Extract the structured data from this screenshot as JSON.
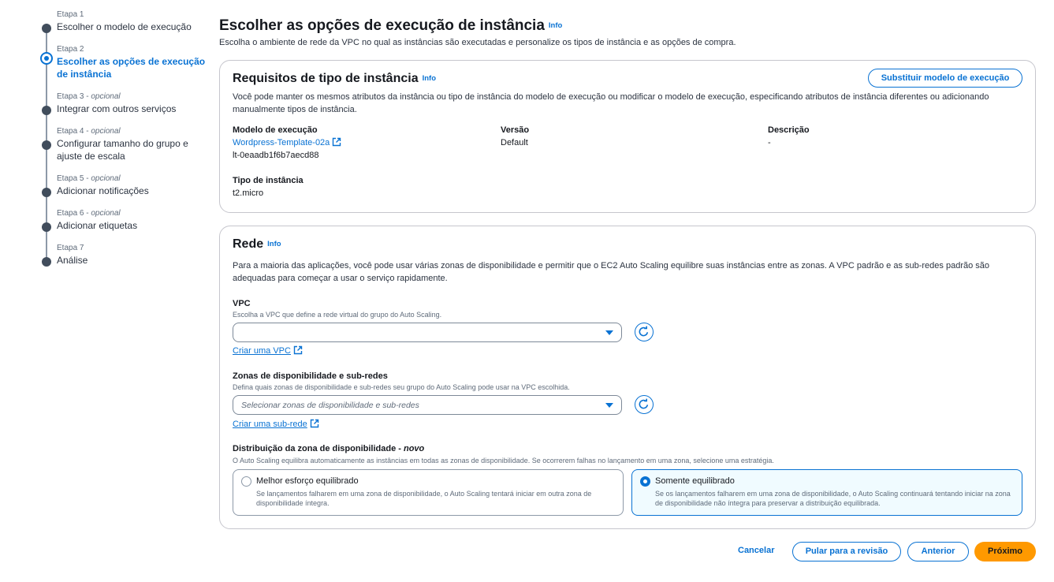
{
  "steps": [
    {
      "num": "Etapa 1",
      "optional": "",
      "label": "Escolher o modelo de execução"
    },
    {
      "num": "Etapa 2",
      "optional": "",
      "label": "Escolher as opções de execução de instância"
    },
    {
      "num": "Etapa 3",
      "optional": "opcional",
      "label": "Integrar com outros serviços"
    },
    {
      "num": "Etapa 4",
      "optional": "opcional",
      "label": "Configurar tamanho do grupo e ajuste de escala"
    },
    {
      "num": "Etapa 5",
      "optional": "opcional",
      "label": "Adicionar notificações"
    },
    {
      "num": "Etapa 6",
      "optional": "opcional",
      "label": "Adicionar etiquetas"
    },
    {
      "num": "Etapa 7",
      "optional": "",
      "label": "Análise"
    }
  ],
  "page": {
    "title": "Escolher as opções de execução de instância",
    "info": "Info",
    "description": "Escolha o ambiente de rede da VPC no qual as instâncias são executadas e personalize os tipos de instância e as opções de compra."
  },
  "instance_req": {
    "title": "Requisitos de tipo de instância",
    "info": "Info",
    "replace_button": "Substituir modelo de execução",
    "description": "Você pode manter os mesmos atributos da instância ou tipo de instância do modelo de execução ou modificar o modelo de execução, especificando atributos de instância diferentes ou adicionando manualmente tipos de instância.",
    "template_label": "Modelo de execução",
    "template_name": "Wordpress-Template-02a",
    "template_id": "lt-0eaadb1f6b7aecd88",
    "version_label": "Versão",
    "version_value": "Default",
    "desc_label": "Descrição",
    "desc_value": "-",
    "type_label": "Tipo de instância",
    "type_value": "t2.micro"
  },
  "network": {
    "title": "Rede",
    "info": "Info",
    "description": "Para a maioria das aplicações, você pode usar várias zonas de disponibilidade e permitir que o EC2 Auto Scaling equilibre suas instâncias entre as zonas. A VPC padrão e as sub-redes padrão são adequadas para começar a usar o serviço rapidamente.",
    "vpc_label": "VPC",
    "vpc_hint": "Escolha a VPC que define a rede virtual do grupo do Auto Scaling.",
    "vpc_value": "",
    "create_vpc": "Criar uma VPC",
    "az_label": "Zonas de disponibilidade e sub-redes",
    "az_hint": "Defina quais zonas de disponibilidade e sub-redes seu grupo do Auto Scaling pode usar na VPC escolhida.",
    "az_placeholder": "Selecionar zonas de disponibilidade e sub-redes",
    "create_subnet": "Criar uma sub-rede",
    "dist_label": "Distribuição da zona de disponibilidade - ",
    "dist_new": "novo",
    "dist_hint": "O Auto Scaling equilibra automaticamente as instâncias em todas as zonas de disponibilidade. Se ocorrerem falhas no lançamento em uma zona, selecione uma estratégia.",
    "option_best": {
      "title": "Melhor esforço equilibrado",
      "desc": "Se lançamentos falharem em uma zona de disponibilidade, o Auto Scaling tentará iniciar em outra zona de disponibilidade íntegra."
    },
    "option_balanced": {
      "title": "Somente equilibrado",
      "desc": "Se os lançamentos falharem em uma zona de disponibilidade, o Auto Scaling continuará tentando iniciar na zona de disponibilidade não íntegra para preservar a distribuição equilibrada."
    },
    "selected_option": "Somente equilibrado"
  },
  "footer": {
    "cancel": "Cancelar",
    "skip": "Pular para a revisão",
    "previous": "Anterior",
    "next": "Próximo"
  },
  "colors": {
    "accent": "#0972d3",
    "primary_button": "#ff9900",
    "selected_tile_bg": "#f0fbff"
  },
  "icons": {
    "external_link": "external-link-icon",
    "refresh": "refresh-icon",
    "caret": "caret-down-icon"
  }
}
